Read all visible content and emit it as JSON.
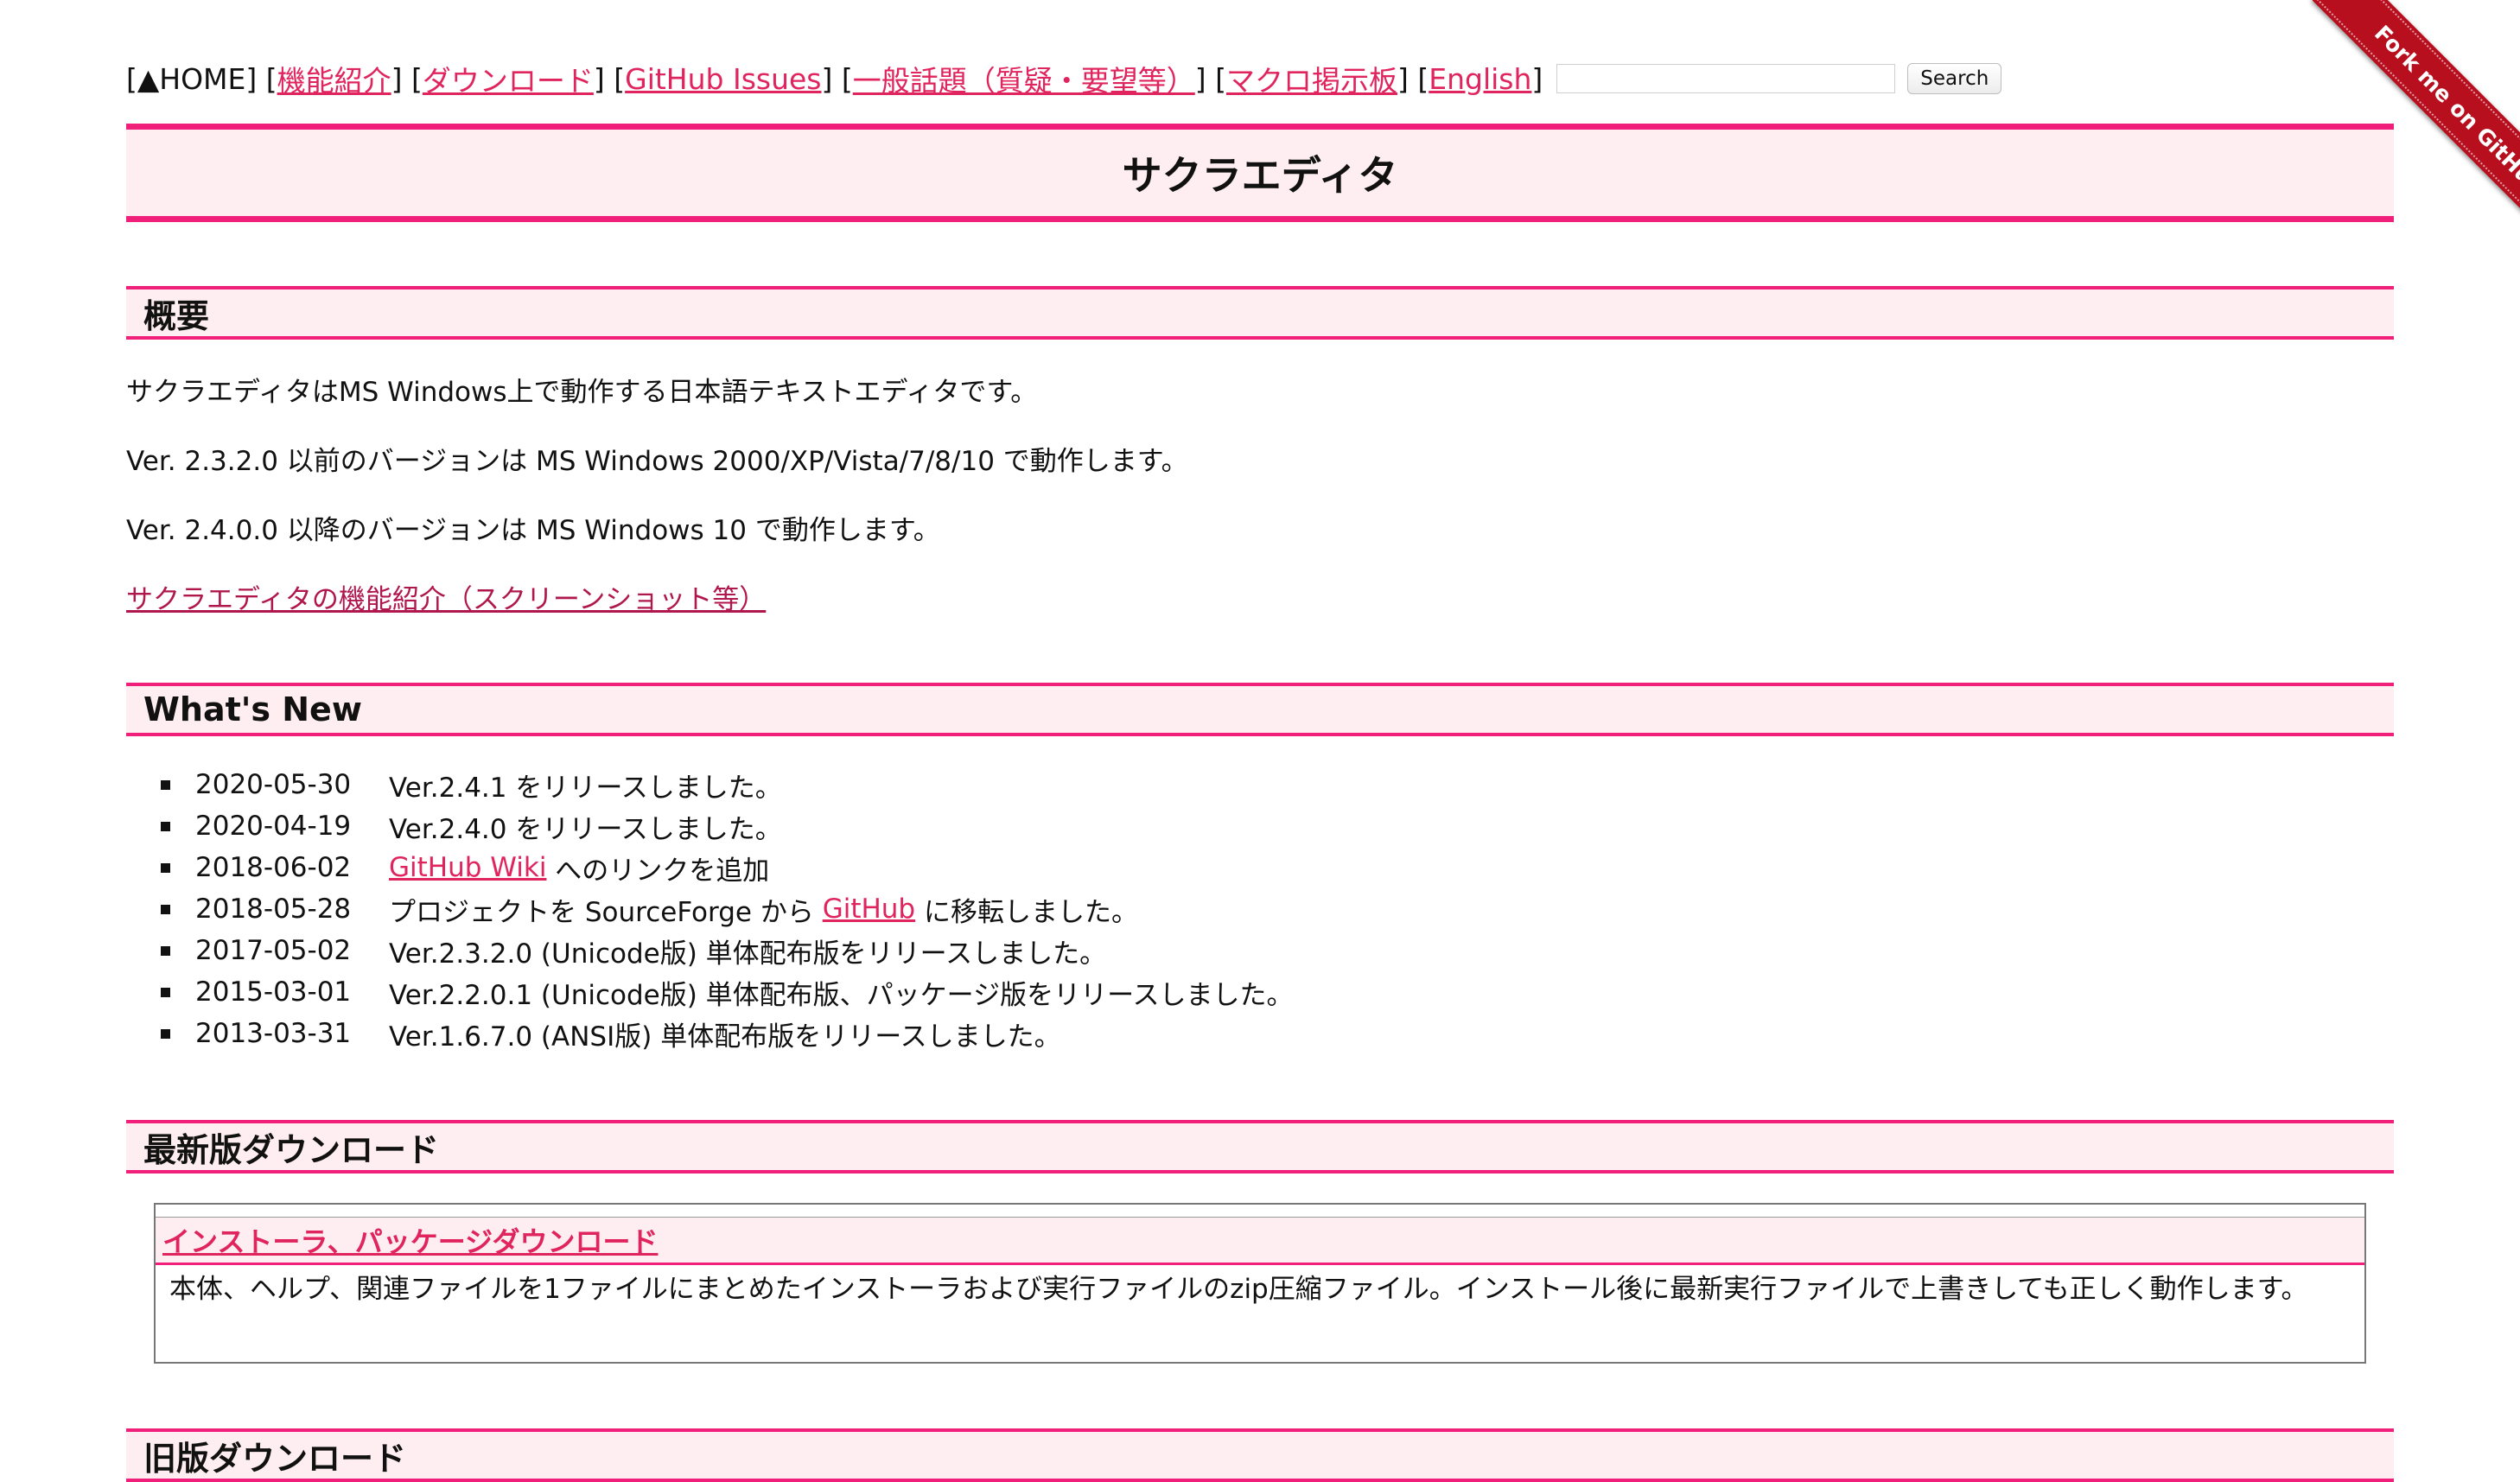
{
  "nav": {
    "home": "▲HOME",
    "links": [
      "機能紹介",
      "ダウンロード",
      "GitHub Issues",
      "一般話題（質疑・要望等）",
      "マクロ掲示板",
      "English"
    ],
    "search_placeholder": "",
    "search_button": "Search"
  },
  "ribbon": "Fork me on GitHub",
  "title": "サクラエディタ",
  "overview": {
    "heading": "概要",
    "p1": "サクラエディタはMS Windows上で動作する日本語テキストエディタです。",
    "p2": "Ver. 2.3.2.0 以前のバージョンは MS Windows 2000/XP/Vista/7/8/10 で動作します。",
    "p3": "Ver. 2.4.0.0 以降のバージョンは MS Windows 10 で動作します。",
    "link": "サクラエディタの機能紹介（スクリーンショット等）"
  },
  "whats_new": {
    "heading": "What's New",
    "items": [
      {
        "date": "2020-05-30",
        "text": "Ver.2.4.1 をリリースしました。"
      },
      {
        "date": "2020-04-19",
        "text": "Ver.2.4.0 をリリースしました。"
      },
      {
        "date": "2018-06-02",
        "link": "GitHub Wiki",
        "text": "へのリンクを追加"
      },
      {
        "date": "2018-05-28",
        "pre": "プロジェクトを SourceForge から",
        "link": "GitHub",
        "text": "に移転しました。"
      },
      {
        "date": "2017-05-02",
        "text": "Ver.2.3.2.0 (Unicode版) 単体配布版をリリースしました。"
      },
      {
        "date": "2015-03-01",
        "text": "Ver.2.2.0.1 (Unicode版) 単体配布版、パッケージ版をリリースしました。"
      },
      {
        "date": "2013-03-31",
        "text": "Ver.1.6.7.0 (ANSI版) 単体配布版をリリースしました。"
      }
    ]
  },
  "latest_download": {
    "heading": "最新版ダウンロード",
    "box_link": "インストーラ、パッケージダウンロード",
    "box_desc": "本体、ヘルプ、関連ファイルを1ファイルにまとめたインストーラおよび実行ファイルのzip圧縮ファイル。インストール後に最新実行ファイルで上書きしても正しく動作します。"
  },
  "old_download": {
    "heading": "旧版ダウンロード"
  },
  "colors": {
    "accent": "#f0207a",
    "link": "#e0245e",
    "heading_bg": "#ffeef1",
    "ribbon": "#b80f1e"
  }
}
